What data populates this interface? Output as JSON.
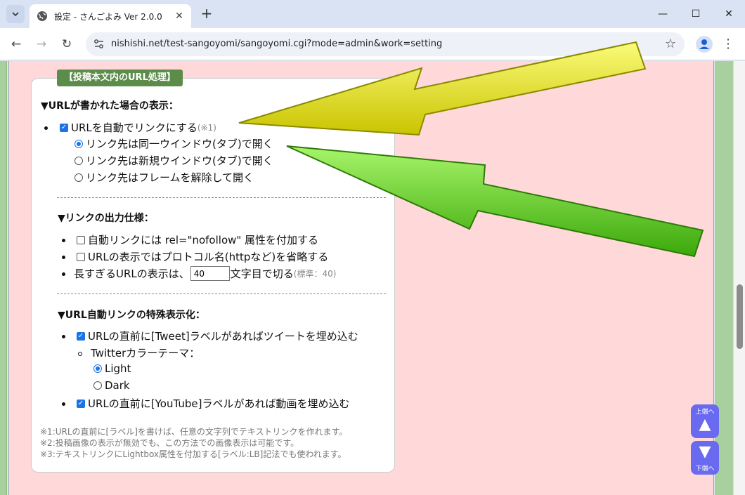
{
  "browser": {
    "tab_title": "設定 - さんごよみ Ver 2.0.0",
    "url": "nishishi.net/test-sangoyomi/sangoyomi.cgi?mode=admin&work=setting",
    "tab_list_icon": "chevron-down",
    "new_tab_icon": "+",
    "minimize_icon": "—",
    "maximize_icon": "☐",
    "close_icon": "✕",
    "back_icon": "←",
    "forward_icon": "→",
    "reload_icon": "↻",
    "bookmark_icon": "☆",
    "menu_icon": "⋮"
  },
  "panel": {
    "title": "【投稿本文内のURL処理】",
    "section1": {
      "heading": "▼URLが書かれた場合の表示：",
      "auto_link": {
        "label": "URLを自動でリンクにする",
        "note": "(※1)",
        "checked": true
      },
      "options": [
        {
          "label": "リンク先は同一ウインドウ(タブ)で開く",
          "checked": true
        },
        {
          "label": "リンク先は新規ウインドウ(タブ)で開く",
          "checked": false
        },
        {
          "label": "リンク先はフレームを解除して開く",
          "checked": false
        }
      ]
    },
    "section2": {
      "heading": "▼リンクの出力仕様：",
      "nofollow": {
        "label": "自動リンクには rel=\"nofollow\" 属性を付加する",
        "checked": false
      },
      "omit_protocol": {
        "label": "URLの表示ではプロトコル名(httpなど)を省略する",
        "checked": false
      },
      "truncate": {
        "prefix": "長すぎるURLの表示は、",
        "value": "40",
        "suffix": "文字目で切る",
        "note": "(標準：40)"
      }
    },
    "section3": {
      "heading": "▼URL自動リンクの特殊表示化：",
      "tweet": {
        "label": "URLの直前に[Tweet]ラベルがあればツイートを埋め込む",
        "checked": true
      },
      "theme_label": "Twitterカラーテーマ：",
      "themes": [
        {
          "label": "Light",
          "checked": true
        },
        {
          "label": "Dark",
          "checked": false
        }
      ],
      "youtube": {
        "label": "URLの直前に[YouTube]ラベルがあれば動画を埋め込む",
        "checked": true
      }
    },
    "footnotes": [
      "※1:URLの直前に[ラベル]を書けば、任意の文字列でテキストリンクを作れます。",
      "※2:投稿画像の表示が無効でも、この方法での画像表示は可能です。",
      "※3:テキストリンクにLightbox属性を付加する[ラベル:LB]記法でも使われます。"
    ]
  },
  "jump": {
    "top_label": "上端へ",
    "bottom_label": "下端へ",
    "up_arrow": "▲",
    "down_arrow": "▼"
  },
  "colors": {
    "page_bg": "#ffd9d9",
    "panel_title_bg": "#5b8c4a",
    "yellow_arrow": "#e6e62a",
    "green_arrow": "#5cd61a",
    "jump_button": "#6a6af0"
  }
}
